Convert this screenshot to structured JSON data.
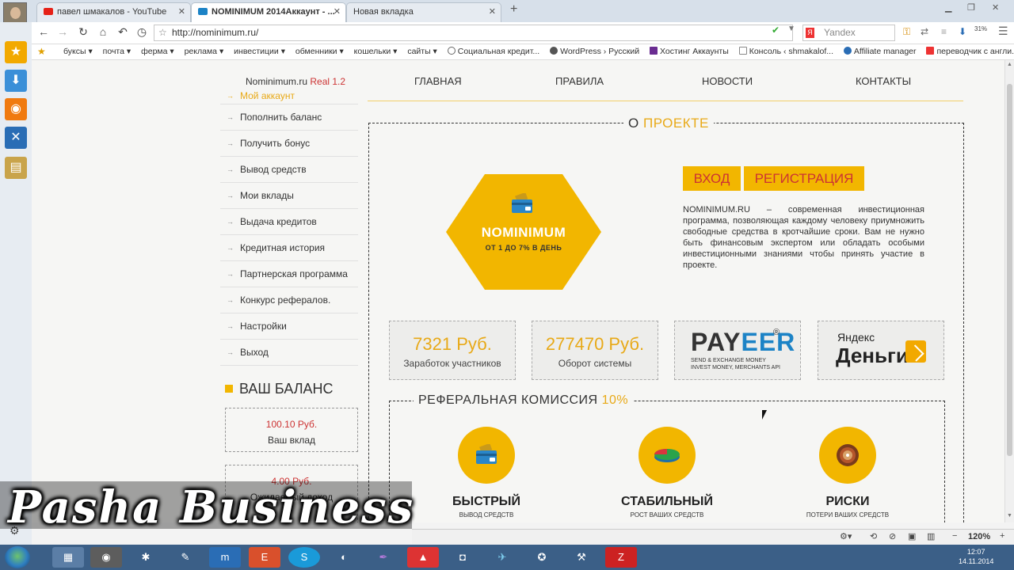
{
  "browser": {
    "tabs": [
      {
        "label": "павел шмакалов - YouTube",
        "favicon_color": "#e62117"
      },
      {
        "label": "NOMINIMUM 2014Аккаунт - ...",
        "favicon_color": "#1c83c6"
      },
      {
        "label": "Новая вкладка",
        "favicon_color": ""
      }
    ],
    "url": "http://nominimum.ru/",
    "search_placeholder": "Yandex",
    "download_percent": "31%",
    "bookmarks": [
      {
        "label": "буксы",
        "dropdown": true
      },
      {
        "label": "почта",
        "dropdown": true
      },
      {
        "label": "ферма",
        "dropdown": true
      },
      {
        "label": "реклама",
        "dropdown": true
      },
      {
        "label": "инвестиции",
        "dropdown": true
      },
      {
        "label": "обменники",
        "dropdown": true
      },
      {
        "label": "кошельки",
        "dropdown": true
      },
      {
        "label": "сайты",
        "dropdown": true
      },
      {
        "label": "Социальная кредит...",
        "dropdown": false
      },
      {
        "label": "WordPress › Русский",
        "dropdown": false
      },
      {
        "label": "Хостинг Аккаунты",
        "dropdown": false
      },
      {
        "label": "Консоль ‹ shmakalof...",
        "dropdown": false
      },
      {
        "label": "Affiliate manager",
        "dropdown": false
      },
      {
        "label": "переводчик с англи...",
        "dropdown": false
      }
    ],
    "zoom": "120%"
  },
  "site": {
    "title": "Nominimum.ru",
    "version": "Real 1.2",
    "nav": [
      "ГЛАВНАЯ",
      "ПРАВИЛА",
      "НОВОСТИ",
      "КОНТАКТЫ"
    ],
    "menu": [
      "Мой аккаунт",
      "Пополнить баланс",
      "Получить бонус",
      "Вывод средств",
      "Мои вклады",
      "Выдача кредитов",
      "Кредитная история",
      "Партнерская программа",
      "Конкурс рефералов.",
      "Настройки",
      "Выход"
    ],
    "balance_title": "ВАШ БАЛАНС",
    "balance": [
      {
        "amount": "100.10 Руб.",
        "label": "Ваш вклад"
      },
      {
        "amount": "4.00 Руб.",
        "label": "Ожидаемый доход"
      }
    ],
    "about_title_prefix": "О",
    "about_title_highlight": "ПРОЕКТЕ",
    "logo_name": "NOMINIMUM",
    "logo_sub": "ОТ 1 ДО 7% В ДЕНЬ",
    "login_label": "ВХОД",
    "register_label": "РЕГИСТРАЦИЯ",
    "about_text": "NOMINIMUM.RU – современная инвестиционная программа, позволяющая каждому человеку приумножить свободные средства в кротчайшие сроки. Вам не нужно быть финансовым экспертом или обладать особыми инвестиционными знаниями чтобы принять участие в проекте.",
    "stats": [
      {
        "value": "7321 Руб.",
        "caption": "Заработок участников"
      },
      {
        "value": "277470 Руб.",
        "caption": "Оборот системы"
      }
    ],
    "payeer": {
      "pay": "PAY",
      "eer": "EER",
      "reg": "®",
      "line1": "SEND & EXCHANGE MONEY",
      "line2": "INVEST MONEY, MERCHANTS API"
    },
    "yandex_money": {
      "line1": "Яндекс",
      "line2": "Деньги"
    },
    "ref_title": "РЕФЕРАЛЬНАЯ КОМИССИЯ",
    "ref_percent": "10%",
    "features": [
      {
        "title": "БЫСТРЫЙ",
        "sub": "ВЫВОД СРЕДСТВ",
        "icon": "wallet-icon"
      },
      {
        "title": "СТАБИЛЬНЫЙ",
        "sub": "РОСТ ВАШИХ СРЕДСТВ",
        "icon": "pie-chart-icon"
      },
      {
        "title": "РИСКИ",
        "sub": "ПОТЕРИ ВАШИХ СРЕДСТВ",
        "icon": "roulette-icon"
      }
    ]
  },
  "watermark": "Pasha Business",
  "taskbar": {
    "time": "12:07",
    "date": "14.11.2014"
  },
  "colors": {
    "accent": "#f2b600",
    "accent_text": "#e8a917",
    "red": "#cc3333"
  }
}
